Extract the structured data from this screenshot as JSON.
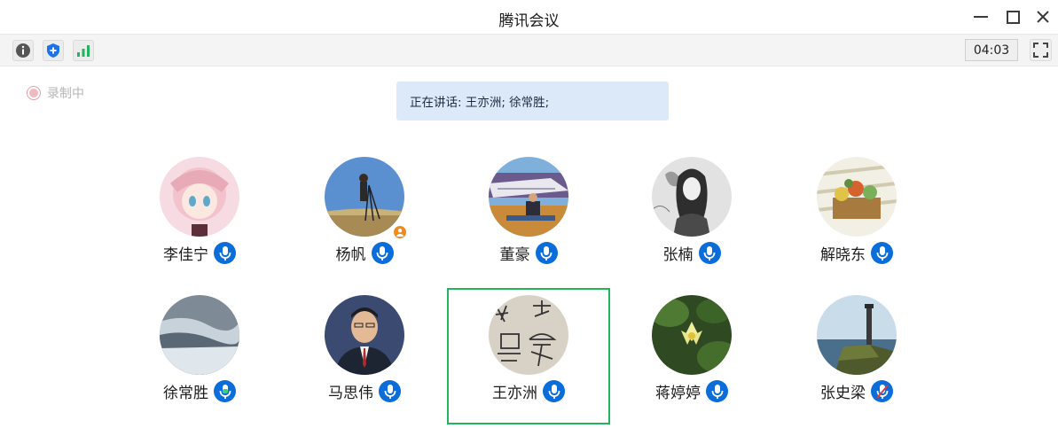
{
  "window": {
    "title": "腾讯会议"
  },
  "toolbar": {
    "timer": "04:03"
  },
  "recording": {
    "label": "录制中"
  },
  "speaking": {
    "text": "正在讲话: 王亦洲; 徐常胜;"
  },
  "participants": [
    {
      "name": "李佳宁",
      "mic": "on"
    },
    {
      "name": "杨帆",
      "mic": "on",
      "host": true
    },
    {
      "name": "董豪",
      "mic": "on"
    },
    {
      "name": "张楠",
      "mic": "on"
    },
    {
      "name": "解晓东",
      "mic": "on"
    },
    {
      "name": "徐常胜",
      "mic": "speaking"
    },
    {
      "name": "马思伟",
      "mic": "on"
    },
    {
      "name": "王亦洲",
      "mic": "on",
      "active": true
    },
    {
      "name": "蒋婷婷",
      "mic": "on"
    },
    {
      "name": "张史梁",
      "mic": "muted"
    }
  ],
  "colors": {
    "mic": "#0a6dd9",
    "active_frame": "#22b55d",
    "speaking_bg": "#dce9f9",
    "host_badge": "#f08a1a"
  }
}
